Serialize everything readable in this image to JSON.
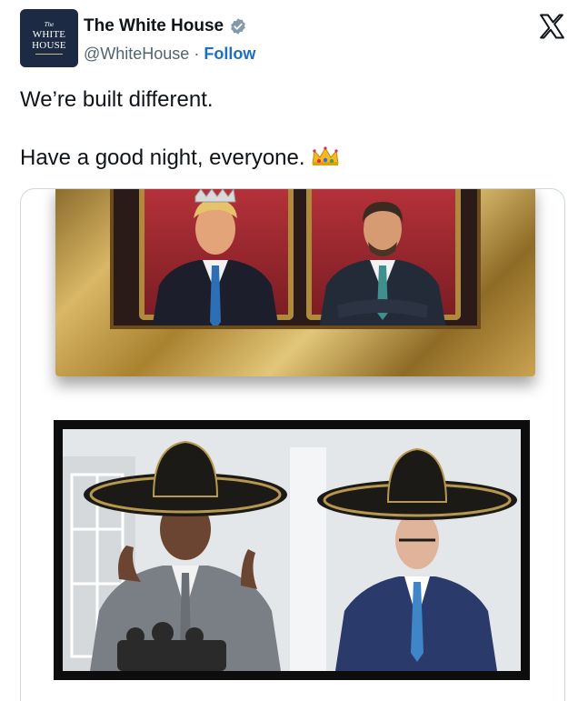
{
  "account": {
    "avatar_line_the": "The",
    "avatar_line_1": "WHITE",
    "avatar_line_2": "HOUSE",
    "display_name": "The White House",
    "handle": "@WhiteHouse",
    "separator": "·",
    "follow_label": "Follow",
    "verified_color": "#829aab"
  },
  "tweet": {
    "line1": "We’re built different.",
    "line2": "Have a good night, everyone.",
    "emoji": "crown-emoji"
  },
  "media": {
    "images": [
      {
        "icon": "gilded-portrait-frame"
      },
      {
        "icon": "press-photo"
      }
    ]
  },
  "colors": {
    "follow": "#1d6fc2",
    "text": "#0f1419",
    "secondary": "#536471"
  }
}
